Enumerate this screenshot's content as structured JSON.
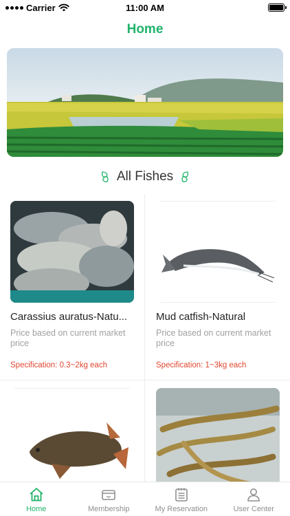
{
  "status_bar": {
    "carrier": "Carrier",
    "time": "11:00 AM"
  },
  "nav": {
    "title": "Home"
  },
  "banner": {
    "image": "rice-paddy-landscape"
  },
  "section": {
    "title": "All Fishes"
  },
  "products": [
    {
      "name": "Carassius auratus-Natu...",
      "price_note": "Price based on current market price",
      "spec": "Specification: 0.3~2kg each",
      "image": "carp-pile-photo"
    },
    {
      "name": "Mud catfish-Natural",
      "price_note": "Price based on current market price",
      "spec": "Specification: 1~3kg each",
      "image": "catfish-photo"
    },
    {
      "name": "",
      "price_note": "",
      "spec": "",
      "image": "common-carp-photo"
    },
    {
      "name": "",
      "price_note": "",
      "spec": "",
      "image": "loach-bucket-photo"
    }
  ],
  "tabs": [
    {
      "label": "Home",
      "icon": "home-icon",
      "active": true
    },
    {
      "label": "Membership",
      "icon": "membership-card-icon",
      "active": false
    },
    {
      "label": "My Reservation",
      "icon": "reservation-list-icon",
      "active": false
    },
    {
      "label": "User Center",
      "icon": "user-icon",
      "active": false
    }
  ],
  "colors": {
    "accent": "#21b36b",
    "spec": "#e0452e",
    "muted": "#a0a0a0"
  }
}
